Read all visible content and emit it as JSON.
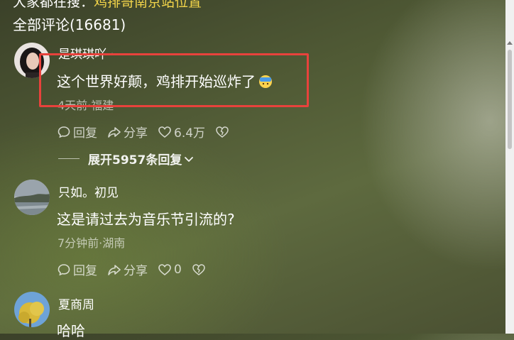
{
  "header": {
    "top_prefix": "大家都在搜：",
    "top_link": "鸡排哥南京站位置",
    "comments_count_label": "全部评论(16681)"
  },
  "comments": [
    {
      "username": "是琪琪吖 ·",
      "text": "这个世界好颠，鸡排开始巡炸了",
      "emoji": "face-with-bandage-emoji",
      "meta": "4天前·福建",
      "reply_label": "回复",
      "share_label": "分享",
      "like_count": "6.4万",
      "expand_label": "展开5957条回复"
    },
    {
      "username": "只如。初见",
      "text": "这是请过去为音乐节引流的?",
      "meta": "7分钟前·湖南",
      "reply_label": "回复",
      "share_label": "分享",
      "like_count": "0"
    },
    {
      "username": "夏商周",
      "text": "哈哈"
    }
  ],
  "icons": {
    "reply": "comment-bubble-icon",
    "share": "share-arrow-icon",
    "like": "heart-icon",
    "dislike": "broken-heart-icon"
  },
  "colors": {
    "highlight_border": "#e8423c",
    "link": "#f3d54a"
  }
}
